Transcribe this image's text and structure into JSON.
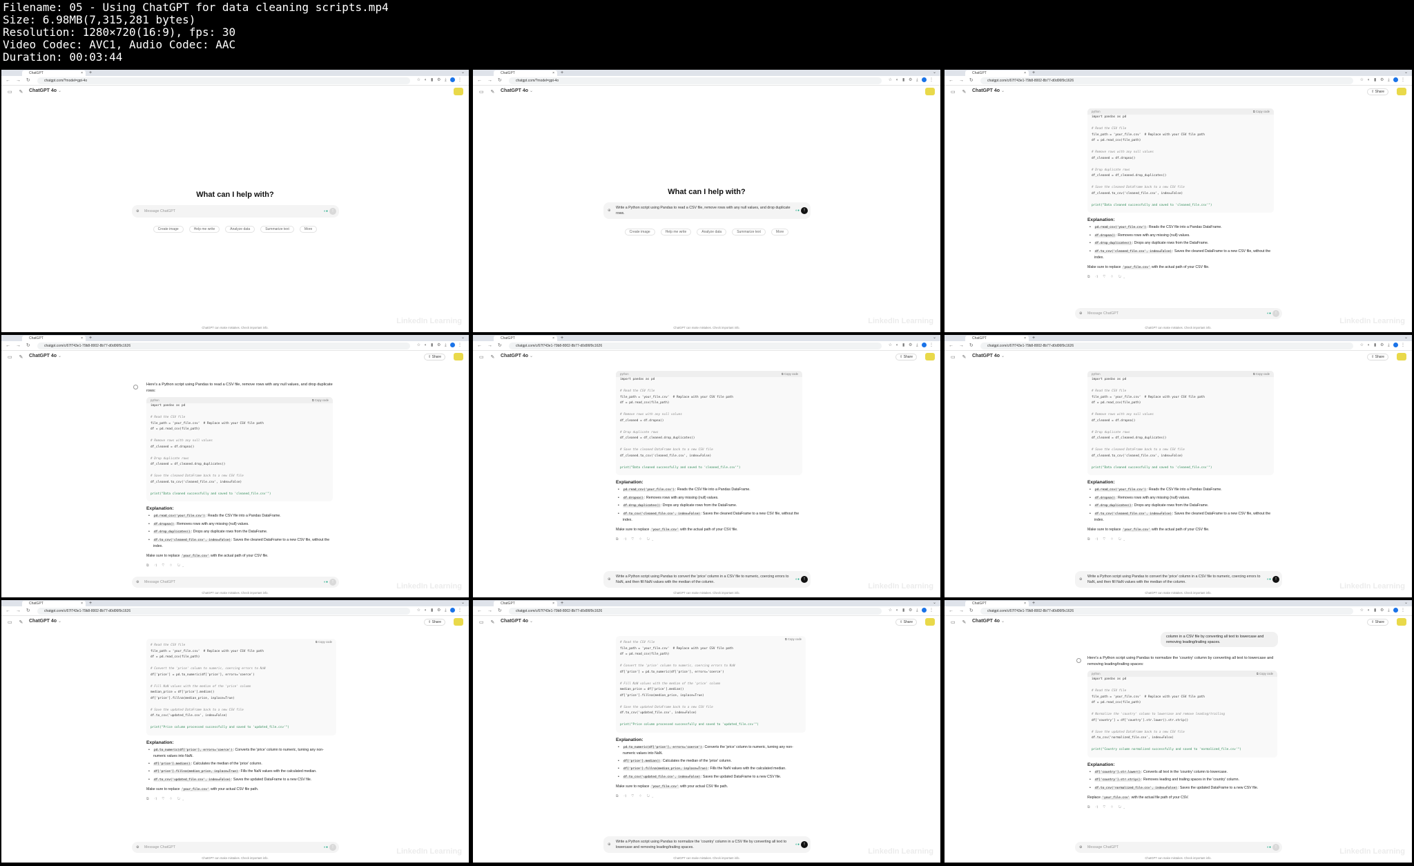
{
  "meta": {
    "filename": "Filename: 05 - Using ChatGPT for data cleaning scripts.mp4",
    "size": "Size: 6.98MB(7,315,281 bytes)",
    "resolution": "Resolution: 1280×720(16:9), fps: 30",
    "codec": "Video Codec: AVC1, Audio Codec: AAC",
    "duration": "Duration: 00:03:44"
  },
  "common": {
    "tab_title": "ChatGPT",
    "model": "ChatGPT 4o",
    "share": "Share",
    "footer": "ChatGPT can make mistakes. Check important info.",
    "watermark": "LinkedIn Learning",
    "url_home": "chatgpt.com/?model=gpt-4o",
    "url_chat": "chatgpt.com/c/67f743e1-79b8-8002-8b77-d0d06f9c1626",
    "greeting": "What can I help with?",
    "placeholder": "Message ChatGPT",
    "copy": "Copy code",
    "lang": "python",
    "explanation": "Explanation:",
    "chips": [
      "Create image",
      "Help me write",
      "Analyze data",
      "Summarize text",
      "More"
    ]
  },
  "prompts": {
    "p1": "Write a Python script using Pandas to read a CSV file, remove rows with any null values, and drop duplicate rows.",
    "p2": "Write a Python script using Pandas to convert the 'price' column in a CSV file to numeric, coercing errors to NaN, and then fill NaN values with the median of the column.",
    "p3": "Write a Python script using Pandas to normalize the 'country' column in a CSV file by converting all text to lowercase and removing leading/trailing spaces.",
    "p3_tail": "column in a CSV file by converting all text to lowercase and removing leading/trailing spaces."
  },
  "answers": {
    "a1_intro": "Here's a Python script using Pandas to read a CSV file, remove rows with any null values, and drop duplicate rows:",
    "a1_code": [
      "import pandas as pd",
      "",
      "# Read the CSV file",
      "file_path = 'your_file.csv'  # Replace with your CSV file path",
      "df = pd.read_csv(file_path)",
      "",
      "# Remove rows with any null values",
      "df_cleaned = df.dropna()",
      "",
      "# Drop duplicate rows",
      "df_cleaned = df_cleaned.drop_duplicates()",
      "",
      "# Save the cleaned DataFrame back to a new CSV file",
      "df_cleaned.to_csv('cleaned_file.csv', index=False)",
      "",
      "print(\"Data cleaned successfully and saved to 'cleaned_file.csv'\")"
    ],
    "a1_bullets": [
      "pd.read_csv('your_file.csv'): Reads the CSV file into a Pandas DataFrame.",
      "df.dropna(): Removes rows with any missing (null) values.",
      "df.drop_duplicates(): Drops any duplicate rows from the DataFrame.",
      "df.to_csv('cleaned_file.csv', index=False): Saves the cleaned DataFrame to a new CSV file, without the index."
    ],
    "a1_note": "Make sure to replace 'your_file.csv' with the actual path of your CSV file.",
    "a2_code": [
      "# Read the CSV file",
      "file_path = 'your_file.csv'  # Replace with your CSV file path",
      "df = pd.read_csv(file_path)",
      "",
      "# Convert the 'price' column to numeric, coercing errors to NaN",
      "df['price'] = pd.to_numeric(df['price'], errors='coerce')",
      "",
      "# Fill NaN values with the median of the 'price' column",
      "median_price = df['price'].median()",
      "df['price'].fillna(median_price, inplace=True)",
      "",
      "# Save the updated DataFrame back to a new CSV file",
      "df.to_csv('updated_file.csv', index=False)",
      "",
      "print(\"Price column processed successfully and saved to 'updated_file.csv'\")"
    ],
    "a2_bullets": [
      "pd.to_numeric(df['price'], errors='coerce'): Converts the 'price' column to numeric, turning any non-numeric values into NaN.",
      "df['price'].median(): Calculates the median of the 'price' column.",
      "df['price'].fillna(median_price, inplace=True): Fills the NaN values with the calculated median.",
      "df.to_csv('updated_file.csv', index=False): Saves the updated DataFrame to a new CSV file."
    ],
    "a2_note": "Make sure to replace 'your_file.csv' with your actual CSV file path.",
    "a3_intro": "Here's a Python script using Pandas to normalize the 'country' column by converting all text to lowercase and removing leading/trailing spaces:",
    "a3_code": [
      "import pandas as pd",
      "",
      "# Read the CSV file",
      "file_path = 'your_file.csv'  # Replace with your CSV file path",
      "df = pd.read_csv(file_path)",
      "",
      "# Normalize the 'country' column to lowercase and remove leading/trailing",
      "df['country'] = df['country'].str.lower().str.strip()",
      "",
      "# Save the updated DataFrame back to a new CSV file",
      "df.to_csv('normalized_file.csv', index=False)",
      "",
      "print(\"Country column normalized successfully and saved to 'normalized_file.csv'\")"
    ],
    "a3_bullets": [
      "df['country'].str.lower(): Converts all text in the 'country' column to lowercase.",
      "df['country'].str.strip(): Removes leading and trailing spaces in the 'country' column.",
      "df.to_csv('normalized_file.csv', index=False): Saves the updated DataFrame to a new CSV file."
    ],
    "a3_note": "Replace 'your_file.csv' with the actual file path of your CSV."
  }
}
